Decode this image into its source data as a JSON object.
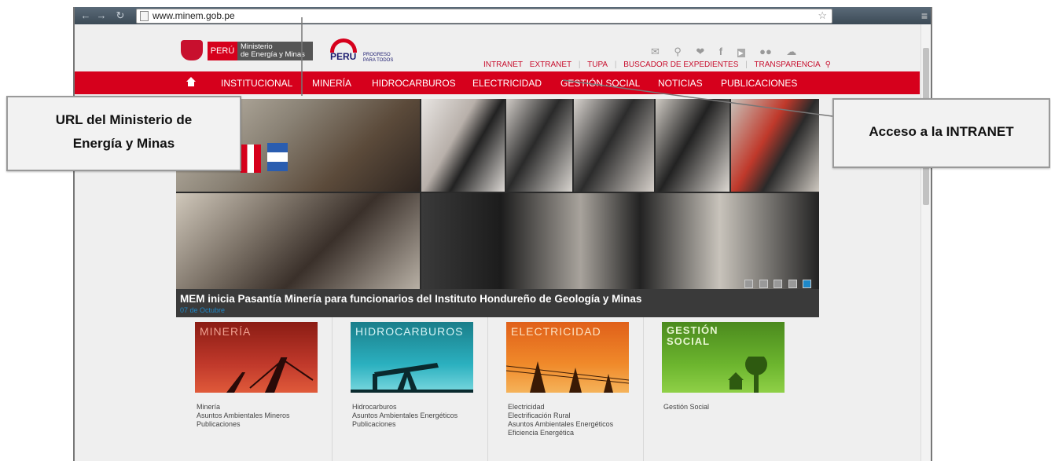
{
  "browser": {
    "url": "www.minem.gob.pe",
    "nav_icons": [
      "back-icon",
      "forward-icon",
      "reload-icon"
    ],
    "star_icon": "star-icon",
    "menu_icon": "menu-icon"
  },
  "header": {
    "peru_label": "PERÚ",
    "ministry_line1": "Ministerio",
    "ministry_line2": "de Energía y Minas",
    "marca_word": "PERU",
    "marca_slogan": "PROGRESO PARA TODOS",
    "social_icons": [
      "mail-icon",
      "search-icon",
      "twitter-icon",
      "facebook-icon",
      "youtube-icon",
      "flickr-icon",
      "cloud-icon"
    ],
    "top_links": [
      "INTRANET",
      "EXTRANET",
      "TUPA",
      "BUSCADOR DE EXPEDIENTES",
      "TRANSPARENCIA"
    ]
  },
  "mainnav": {
    "items": [
      "INSTITUCIONAL",
      "MINERÍA",
      "HIDROCARBUROS",
      "ELECTRICIDAD",
      "GESTIÓN SOCIAL",
      "NOTICIAS",
      "PUBLICACIONES"
    ]
  },
  "slider": {
    "title": "MEM inicia Pasantía Minería para funcionarios del Instituto Hondureño de Geología y Minas",
    "date": "07 de Octubre",
    "slide_count": 5,
    "active_slide": 5
  },
  "sections": [
    {
      "banner": "MINERÍA",
      "links": [
        "Minería",
        "Asuntos Ambientales Mineros",
        "Publicaciones"
      ]
    },
    {
      "banner": "HIDROCARBUROS",
      "links": [
        "Hidrocarburos",
        "Asuntos Ambientales Energéticos",
        "Publicaciones"
      ]
    },
    {
      "banner": "ELECTRICIDAD",
      "links": [
        "Electricidad",
        "Electrificación Rural",
        "Asuntos Ambientales Energéticos",
        "Eficiencia Energética"
      ]
    },
    {
      "banner_line1": "GESTIÓN",
      "banner_line2": "SOCIAL",
      "links": [
        "Gestión Social"
      ]
    }
  ],
  "callouts": {
    "url_line1": "URL del Ministerio de",
    "url_line2": "Energía y Minas",
    "intranet": "Acceso a la INTRANET"
  }
}
